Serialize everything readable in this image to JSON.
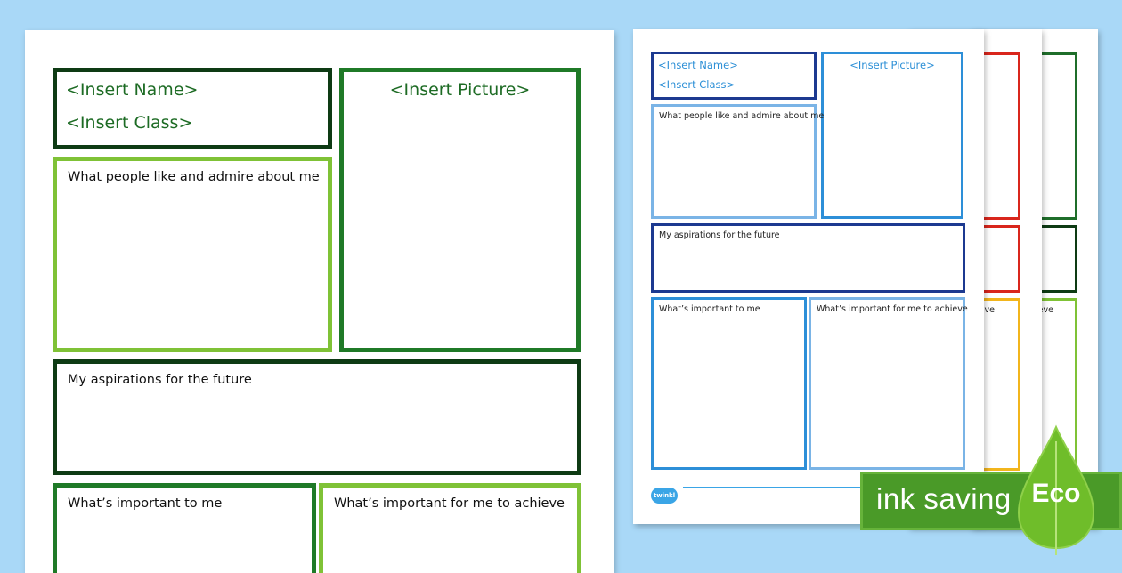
{
  "main_sheet": {
    "name_placeholder": "<Insert Name>",
    "class_placeholder": "<Insert Class>",
    "picture_placeholder": "<Insert Picture>",
    "admire_label": "What people like and admire about me",
    "aspirations_label": "My aspirations for the future",
    "important_label": "What’s important to me",
    "achieve_label": "What’s important for me to achieve"
  },
  "front_sheet": {
    "name_placeholder": "<Insert Name>",
    "class_placeholder": "<Insert Class>",
    "picture_placeholder": "<Insert Picture>",
    "admire_label": "What people like and admire about me",
    "aspirations_label": "My aspirations for the future",
    "important_label": "What’s important to me",
    "achieve_label": "What’s important for me to achieve",
    "logo_text": "twinkl"
  },
  "back_sheets": {
    "red_fragment": "hieve",
    "green_fragment": "hieve"
  },
  "eco_badge": {
    "banner_text": "ink saving",
    "leaf_text": "Eco"
  },
  "colors": {
    "background": "#a9d8f7",
    "dark_green": "#0e3b14",
    "mid_green": "#1f7a27",
    "light_green": "#7fc236",
    "navy": "#1c3990",
    "blue": "#2d8fd8",
    "light_blue": "#7ab4e6",
    "red": "#d9261c",
    "yellow": "#f2b51c",
    "eco_green": "#4a9a28"
  }
}
